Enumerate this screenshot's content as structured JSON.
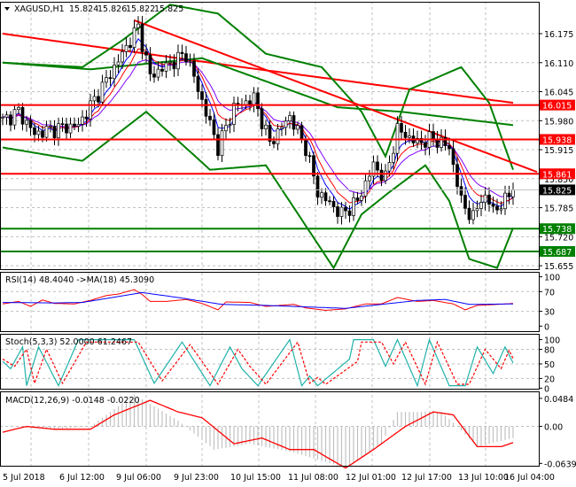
{
  "header": {
    "symbol": "XAGUSD,H1",
    "open": "15.824",
    "high": "15.826",
    "low": "15.822",
    "close": "15.825"
  },
  "colors": {
    "bull": "#000000",
    "bear": "#000000",
    "level_red": "#ff0000",
    "level_green": "#008000",
    "band": "#008000",
    "rsi": "#ff0000",
    "rsi_ma": "#0000ff",
    "stoch_main": "#20b2aa",
    "stoch_signal": "#ff0000",
    "macd": "#ff0000",
    "hist": "#c0c0c0"
  },
  "chart_data": [
    {
      "type": "candlestick",
      "title": "XAGUSD,H1",
      "ylim": [
        15.63,
        16.25
      ],
      "y_ticks": [
        "16.175",
        "16.110",
        "16.045",
        "15.980",
        "15.915",
        "15.850",
        "15.785",
        "15.720",
        "15.655"
      ],
      "x_ticks": [
        "5 Jul 2018",
        "6 Jul 12:00",
        "9 Jul 06:00",
        "9 Jul 23:00",
        "10 Jul 15:00",
        "11 Jul 08:00",
        "12 Jul 01:00",
        "12 Jul 17:00",
        "13 Jul 10:00",
        "16 Jul 04:00"
      ],
      "bars": 129,
      "close_keypoints": [
        [
          0,
          15.98
        ],
        [
          4,
          16.0
        ],
        [
          8,
          15.95
        ],
        [
          12,
          15.96
        ],
        [
          19,
          15.97
        ],
        [
          26,
          16.07
        ],
        [
          34,
          16.19
        ],
        [
          37,
          16.08
        ],
        [
          46,
          16.13
        ],
        [
          49,
          16.05
        ],
        [
          54,
          15.92
        ],
        [
          58,
          16.01
        ],
        [
          63,
          16.03
        ],
        [
          67,
          15.93
        ],
        [
          72,
          15.99
        ],
        [
          76,
          15.92
        ],
        [
          79,
          15.82
        ],
        [
          85,
          15.77
        ],
        [
          89,
          15.8
        ],
        [
          93,
          15.88
        ],
        [
          96,
          15.85
        ],
        [
          99,
          15.96
        ],
        [
          104,
          15.93
        ],
        [
          108,
          15.94
        ],
        [
          112,
          15.92
        ],
        [
          115,
          15.8
        ],
        [
          118,
          15.76
        ],
        [
          120,
          15.81
        ],
        [
          124,
          15.78
        ],
        [
          128,
          15.825
        ]
      ],
      "bollinger_upper": [
        [
          0,
          16.11
        ],
        [
          20,
          16.1
        ],
        [
          30,
          16.16
        ],
        [
          42,
          16.24
        ],
        [
          54,
          16.22
        ],
        [
          66,
          16.13
        ],
        [
          80,
          16.1
        ],
        [
          90,
          16.0
        ],
        [
          96,
          15.9
        ],
        [
          102,
          16.05
        ],
        [
          115,
          16.1
        ],
        [
          122,
          16.02
        ],
        [
          128,
          15.87
        ]
      ],
      "bollinger_lower": [
        [
          0,
          15.92
        ],
        [
          20,
          15.89
        ],
        [
          36,
          16.0
        ],
        [
          52,
          15.87
        ],
        [
          66,
          15.88
        ],
        [
          83,
          15.65
        ],
        [
          90,
          15.77
        ],
        [
          97,
          15.82
        ],
        [
          106,
          15.88
        ],
        [
          112,
          15.8
        ],
        [
          117,
          15.67
        ],
        [
          124,
          15.65
        ],
        [
          128,
          15.74
        ]
      ],
      "long_ma_green": [
        [
          0,
          16.11
        ],
        [
          22,
          16.095
        ],
        [
          50,
          16.12
        ],
        [
          84,
          16.01
        ],
        [
          100,
          16.0
        ],
        [
          128,
          15.97
        ]
      ],
      "long_ma_red": [
        [
          0,
          16.175
        ],
        [
          60,
          16.1
        ],
        [
          128,
          16.02
        ]
      ],
      "trendline": [
        [
          33,
          16.205
        ],
        [
          134,
          15.865
        ]
      ],
      "levels": [
        {
          "value": "16.015",
          "color": "red"
        },
        {
          "value": "15.938",
          "color": "red"
        },
        {
          "value": "15.861",
          "color": "red"
        },
        {
          "value": "15.738",
          "color": "green"
        },
        {
          "value": "15.687",
          "color": "green"
        }
      ],
      "current_price": "15.825"
    },
    {
      "type": "line",
      "title": "RSI(14) 48.4040  ->MA(18) 45.3090",
      "ylim": [
        0,
        100
      ],
      "y_ticks": [
        "100",
        "70",
        "30",
        "0"
      ],
      "series": [
        {
          "name": "RSI",
          "points": [
            [
              0,
              45
            ],
            [
              4,
              50
            ],
            [
              7,
              40
            ],
            [
              10,
              53
            ],
            [
              13,
              46
            ],
            [
              18,
              45
            ],
            [
              22,
              52
            ],
            [
              26,
              62
            ],
            [
              29,
              65
            ],
            [
              33,
              74
            ],
            [
              35,
              64
            ],
            [
              37,
              50
            ],
            [
              41,
              50
            ],
            [
              46,
              54
            ],
            [
              50,
              46
            ],
            [
              54,
              33
            ],
            [
              56,
              49
            ],
            [
              62,
              48
            ],
            [
              66,
              40
            ],
            [
              73,
              44
            ],
            [
              76,
              37
            ],
            [
              81,
              32
            ],
            [
              86,
              35
            ],
            [
              91,
              45
            ],
            [
              95,
              45
            ],
            [
              99,
              58
            ],
            [
              104,
              50
            ],
            [
              108,
              52
            ],
            [
              113,
              45
            ],
            [
              116,
              33
            ],
            [
              119,
              42
            ],
            [
              124,
              44
            ],
            [
              128,
              46
            ]
          ]
        },
        {
          "name": "MA",
          "points": [
            [
              0,
              48
            ],
            [
              13,
              47
            ],
            [
              20,
              48
            ],
            [
              35,
              68
            ],
            [
              44,
              58
            ],
            [
              55,
              44
            ],
            [
              66,
              42
            ],
            [
              86,
              36
            ],
            [
              95,
              44
            ],
            [
              104,
              52
            ],
            [
              111,
              54
            ],
            [
              117,
              44
            ],
            [
              128,
              45
            ]
          ]
        }
      ]
    },
    {
      "type": "line",
      "title": "Stoch(5,3,3) 52.0000 61.2467",
      "ylim": [
        0,
        100
      ],
      "y_ticks": [
        "100",
        "80",
        "50",
        "20",
        "0"
      ],
      "series": [
        {
          "name": "main",
          "points": [
            [
              0,
              55
            ],
            [
              2,
              40
            ],
            [
              5,
              85
            ],
            [
              6,
              5
            ],
            [
              9,
              85
            ],
            [
              14,
              5
            ],
            [
              19,
              100
            ],
            [
              33,
              100
            ],
            [
              38,
              10
            ],
            [
              45,
              95
            ],
            [
              52,
              5
            ],
            [
              57,
              85
            ],
            [
              60,
              40
            ],
            [
              64,
              5
            ],
            [
              72,
              100
            ],
            [
              75,
              5
            ],
            [
              77,
              25
            ],
            [
              79,
              5
            ],
            [
              87,
              60
            ],
            [
              88,
              100
            ],
            [
              93,
              100
            ],
            [
              96,
              45
            ],
            [
              99,
              100
            ],
            [
              104,
              5
            ],
            [
              107,
              100
            ],
            [
              112,
              5
            ],
            [
              116,
              5
            ],
            [
              119,
              85
            ],
            [
              123,
              30
            ],
            [
              126,
              85
            ],
            [
              128,
              52
            ]
          ]
        },
        {
          "name": "signal",
          "points": [
            [
              0,
              60
            ],
            [
              3,
              45
            ],
            [
              6,
              80
            ],
            [
              8,
              10
            ],
            [
              11,
              80
            ],
            [
              15,
              10
            ],
            [
              21,
              95
            ],
            [
              34,
              95
            ],
            [
              40,
              15
            ],
            [
              47,
              90
            ],
            [
              54,
              8
            ],
            [
              59,
              80
            ],
            [
              62,
              45
            ],
            [
              66,
              8
            ],
            [
              74,
              95
            ],
            [
              77,
              10
            ],
            [
              79,
              22
            ],
            [
              81,
              8
            ],
            [
              89,
              55
            ],
            [
              90,
              95
            ],
            [
              95,
              95
            ],
            [
              98,
              50
            ],
            [
              101,
              95
            ],
            [
              106,
              8
            ],
            [
              109,
              95
            ],
            [
              114,
              8
            ],
            [
              117,
              8
            ],
            [
              121,
              80
            ],
            [
              125,
              40
            ],
            [
              127,
              78
            ],
            [
              128,
              61
            ]
          ]
        }
      ]
    },
    {
      "type": "bar+line",
      "title": "MACD(12,26,9) -0.0148 -0.0220",
      "ylim": [
        -0.0639,
        0.0484
      ],
      "y_ticks": [
        "0.0484",
        "0.00",
        "-0.0639"
      ],
      "signal": [
        [
          0,
          -0.01
        ],
        [
          6,
          0
        ],
        [
          13,
          -0.005
        ],
        [
          22,
          -0.005
        ],
        [
          28,
          0.02
        ],
        [
          37,
          0.045
        ],
        [
          44,
          0.025
        ],
        [
          50,
          0.015
        ],
        [
          58,
          -0.03
        ],
        [
          65,
          -0.02
        ],
        [
          72,
          -0.04
        ],
        [
          78,
          -0.04
        ],
        [
          86,
          -0.072
        ],
        [
          93,
          -0.04
        ],
        [
          101,
          0.0
        ],
        [
          108,
          0.025
        ],
        [
          113,
          0.02
        ],
        [
          119,
          -0.035
        ],
        [
          125,
          -0.035
        ],
        [
          128,
          -0.028
        ]
      ],
      "histogram": [
        [
          0,
          0
        ],
        [
          13,
          -0.005
        ],
        [
          22,
          0
        ],
        [
          33,
          0.055
        ],
        [
          44,
          0.01
        ],
        [
          53,
          -0.04
        ],
        [
          62,
          -0.03
        ],
        [
          73,
          -0.045
        ],
        [
          86,
          -0.072
        ],
        [
          95,
          -0.03
        ],
        [
          99,
          0.025
        ],
        [
          110,
          0.025
        ],
        [
          114,
          0
        ],
        [
          119,
          -0.035
        ],
        [
          128,
          -0.02
        ]
      ]
    }
  ]
}
